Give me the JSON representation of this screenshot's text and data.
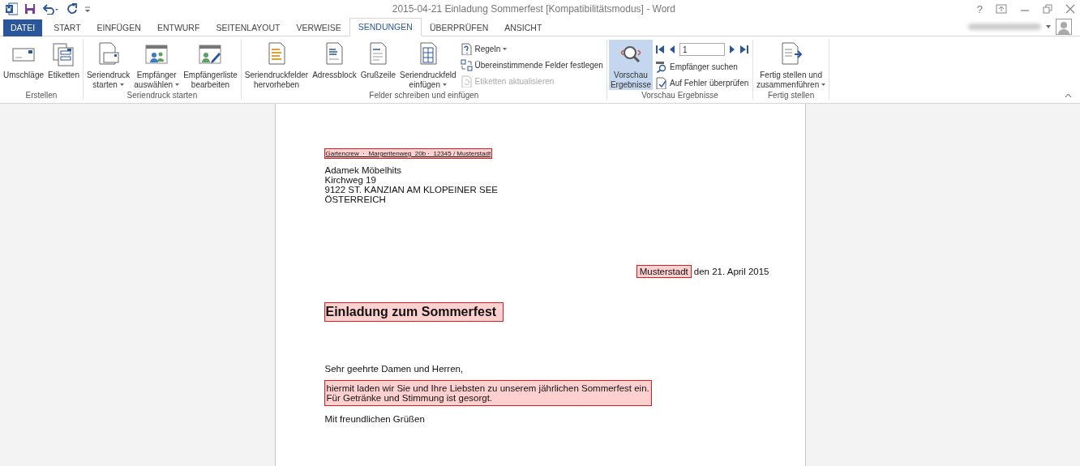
{
  "window": {
    "title": "2015-04-21 Einladung Sommerfest [Kompatibilitätsmodus] - Word",
    "help": "?"
  },
  "tabs": [
    {
      "label": "DATEI",
      "kind": "file",
      "selected": false
    },
    {
      "label": "START",
      "kind": "tab",
      "selected": false
    },
    {
      "label": "EINFÜGEN",
      "kind": "tab",
      "selected": false
    },
    {
      "label": "ENTWURF",
      "kind": "tab",
      "selected": false
    },
    {
      "label": "SEITENLAYOUT",
      "kind": "tab",
      "selected": false
    },
    {
      "label": "VERWEISE",
      "kind": "tab",
      "selected": false
    },
    {
      "label": "SENDUNGEN",
      "kind": "tab",
      "selected": true
    },
    {
      "label": "ÜBERPRÜFEN",
      "kind": "tab",
      "selected": false
    },
    {
      "label": "ANSICHT",
      "kind": "tab",
      "selected": false
    }
  ],
  "ribbon": {
    "groups": [
      {
        "label": "Erstellen",
        "commands": [
          {
            "kind": "large",
            "lines": [
              "Umschläge"
            ],
            "dropdown": false,
            "selected": false
          },
          {
            "kind": "large",
            "lines": [
              "Etiketten"
            ],
            "dropdown": false,
            "selected": false
          }
        ]
      },
      {
        "label": "Seriendruck starten",
        "commands": [
          {
            "kind": "large",
            "lines": [
              "Seriendruck",
              "starten"
            ],
            "dropdown": true,
            "selected": false
          },
          {
            "kind": "large",
            "lines": [
              "Empfänger",
              "auswählen"
            ],
            "dropdown": true,
            "selected": false
          },
          {
            "kind": "large",
            "lines": [
              "Empfängerliste",
              "bearbeiten"
            ],
            "dropdown": false,
            "selected": false
          }
        ]
      },
      {
        "label": "Felder schreiben und einfügen",
        "commands": [
          {
            "kind": "large",
            "lines": [
              "Seriendruckfelder",
              "hervorheben"
            ],
            "dropdown": false,
            "selected": false
          },
          {
            "kind": "large",
            "lines": [
              "Adressblock"
            ],
            "dropdown": false,
            "selected": false
          },
          {
            "kind": "large",
            "lines": [
              "Grußzeile"
            ],
            "dropdown": false,
            "selected": false
          },
          {
            "kind": "large",
            "lines": [
              "Seriendruckfeld",
              "einfügen"
            ],
            "dropdown": true,
            "selected": false
          },
          {
            "kind": "small",
            "label": "Regeln",
            "dropdown": true,
            "disabled": false
          },
          {
            "kind": "small",
            "label": "Übereinstimmende Felder festlegen",
            "dropdown": false,
            "disabled": false
          },
          {
            "kind": "small",
            "label": "Etiketten aktualisieren",
            "dropdown": false,
            "disabled": true
          }
        ]
      },
      {
        "label": "Vorschau Ergebnisse",
        "commands": [
          {
            "kind": "large",
            "lines": [
              "Vorschau",
              "Ergebnisse"
            ],
            "dropdown": false,
            "selected": true
          },
          {
            "kind": "nav",
            "record": "1"
          },
          {
            "kind": "small",
            "label": "Empfänger suchen",
            "dropdown": false,
            "disabled": false
          },
          {
            "kind": "small",
            "label": "Auf Fehler überprüfen",
            "dropdown": false,
            "disabled": false
          }
        ]
      },
      {
        "label": "Fertig stellen",
        "commands": [
          {
            "kind": "large",
            "lines": [
              "Fertig stellen und",
              "zusammenführen"
            ],
            "dropdown": true,
            "selected": false
          }
        ]
      }
    ]
  },
  "document": {
    "sender": {
      "text": "Gartencrew  ·  Margeritenweg  20b ·  12345 / Musterstadt",
      "highlighted": true
    },
    "address": [
      "Adamek Möbelhits",
      "Kirchweg 19",
      "9122 ST. KANZIAN AM KLOPEINER SEE",
      "ÖSTERREICH"
    ],
    "place": {
      "text": "Musterstadt",
      "highlighted": true
    },
    "date": "den 21. April 2015",
    "subject": {
      "text": "Einladung zum Sommerfest",
      "highlighted": true
    },
    "salutation": "Sehr geehrte Damen und Herren,",
    "body": {
      "lines": [
        "hiermit laden wir Sie und Ihre Liebsten zu unserem jährlichen Sommerfest ein.",
        "Für Getränke und Stimmung ist gesorgt."
      ],
      "highlighted": true
    },
    "closing": "Mit freundlichen Grüßen"
  }
}
